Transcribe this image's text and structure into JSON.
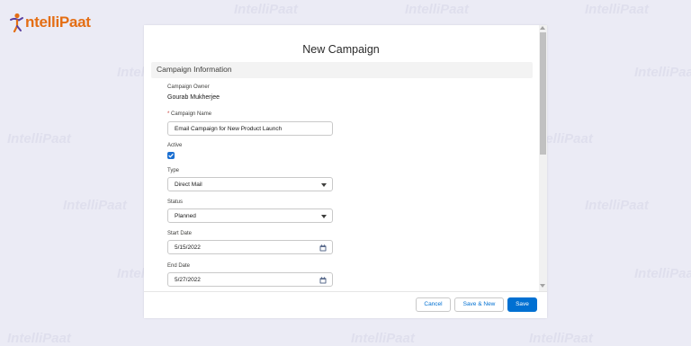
{
  "brand": {
    "logo_text": "ntelliPaat",
    "logo_color": "#e46e14",
    "watermark_text": "IntelliPaat"
  },
  "modal": {
    "title": "New Campaign",
    "section_title": "Campaign Information",
    "fields": {
      "owner_label": "Campaign Owner",
      "owner_value": "Gourab Mukherjee",
      "name_required_marker": "*",
      "name_label": "Campaign Name",
      "name_value": "Email Campaign for New Product Launch",
      "active_label": "Active",
      "active_checked": true,
      "type_label": "Type",
      "type_value": "Direct Mail",
      "status_label": "Status",
      "status_value": "Planned",
      "start_label": "Start Date",
      "start_value": "5/15/2022",
      "end_label": "End Date",
      "end_value": "5/27/2022"
    },
    "buttons": {
      "cancel": "Cancel",
      "save_new": "Save & New",
      "save": "Save"
    }
  },
  "colors": {
    "accent": "#0070d2",
    "background": "#ebebf5",
    "required": "#c23934"
  },
  "icons": [
    "check-icon",
    "chevron-down-icon",
    "calendar-icon"
  ]
}
